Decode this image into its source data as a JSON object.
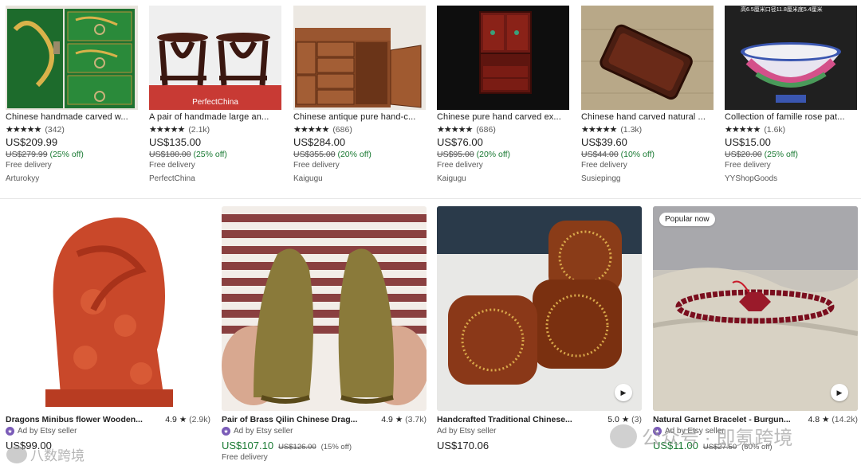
{
  "row1": [
    {
      "title": "Chinese handmade carved w...",
      "rating_count": "(342)",
      "price": "US$209.99",
      "original": "US$279.99",
      "discount": "(25% off)",
      "delivery": "Free delivery",
      "shop": "Arturokyy",
      "image": "green-lacquer-cabinet"
    },
    {
      "title": "A pair of handmade large an...",
      "rating_count": "(2.1k)",
      "price": "US$135.00",
      "original": "US$180.00",
      "discount": "(25% off)",
      "delivery": "Free delivery",
      "shop": "PerfectChina",
      "image": "wooden-stands",
      "image_caption": "PerfectChina"
    },
    {
      "title": "Chinese antique pure hand-c...",
      "rating_count": "(686)",
      "price": "US$284.00",
      "original": "US$355.00",
      "discount": "(20% off)",
      "delivery": "Free delivery",
      "shop": "Kaigugu",
      "image": "drawer-cabinet"
    },
    {
      "title": "Chinese pure hand carved ex...",
      "rating_count": "(686)",
      "price": "US$76.00",
      "original": "US$95.00",
      "discount": "(20% off)",
      "delivery": "Free delivery",
      "shop": "Kaigugu",
      "image": "red-miniature-cabinet"
    },
    {
      "title": "Chinese hand carved natural ...",
      "rating_count": "(1.3k)",
      "price": "US$39.60",
      "original": "US$44.00",
      "discount": "(10% off)",
      "delivery": "Free delivery",
      "shop": "Susiepingg",
      "image": "wooden-tray"
    },
    {
      "title": "Collection of famille rose pat...",
      "rating_count": "(1.6k)",
      "price": "US$15.00",
      "original": "US$20.00",
      "discount": "(25% off)",
      "delivery": "Free delivery",
      "shop": "YYShopGoods",
      "image": "porcelain-bowl",
      "image_caption": "高6.5厘米口径11.8厘米底5.4厘米"
    }
  ],
  "stars_glyph": "★★★★★",
  "row2": [
    {
      "title": "Dragons Minibus flower Wooden...",
      "rating": "4.9",
      "rating_count": "(2.9k)",
      "ad": "Ad by Etsy seller",
      "price": "US$99.00",
      "image": "dragon-carving"
    },
    {
      "title": "Pair of Brass Qilin Chinese Drag...",
      "rating": "4.9",
      "rating_count": "(3.7k)",
      "ad": "Ad by Etsy seller",
      "price": "US$107.10",
      "original": "US$126.00",
      "discount": "(15% off)",
      "delivery": "Free delivery",
      "image": "brass-qilin"
    },
    {
      "title": "Handcrafted Traditional Chinese...",
      "rating": "5.0",
      "rating_count": "(3)",
      "ad": "Ad by Etsy seller",
      "price": "US$170.06",
      "image": "wooden-dice",
      "play": true
    },
    {
      "title": "Natural Garnet Bracelet - Burgun...",
      "rating": "4.8",
      "rating_count": "(14.2k)",
      "ad": "Ad by Etsy seller",
      "price": "US$11.00",
      "original": "US$27.50",
      "discount": "(60% off)",
      "image": "garnet-bracelet",
      "badge": "Popular now",
      "play": true
    }
  ],
  "watermark_left": "八数跨境",
  "watermark_right": "公众号 · 即氪跨境",
  "colors": {
    "sale": "#1a7a33",
    "ad_star": "#7b5cb8",
    "text": "#222222",
    "muted": "#595959"
  }
}
